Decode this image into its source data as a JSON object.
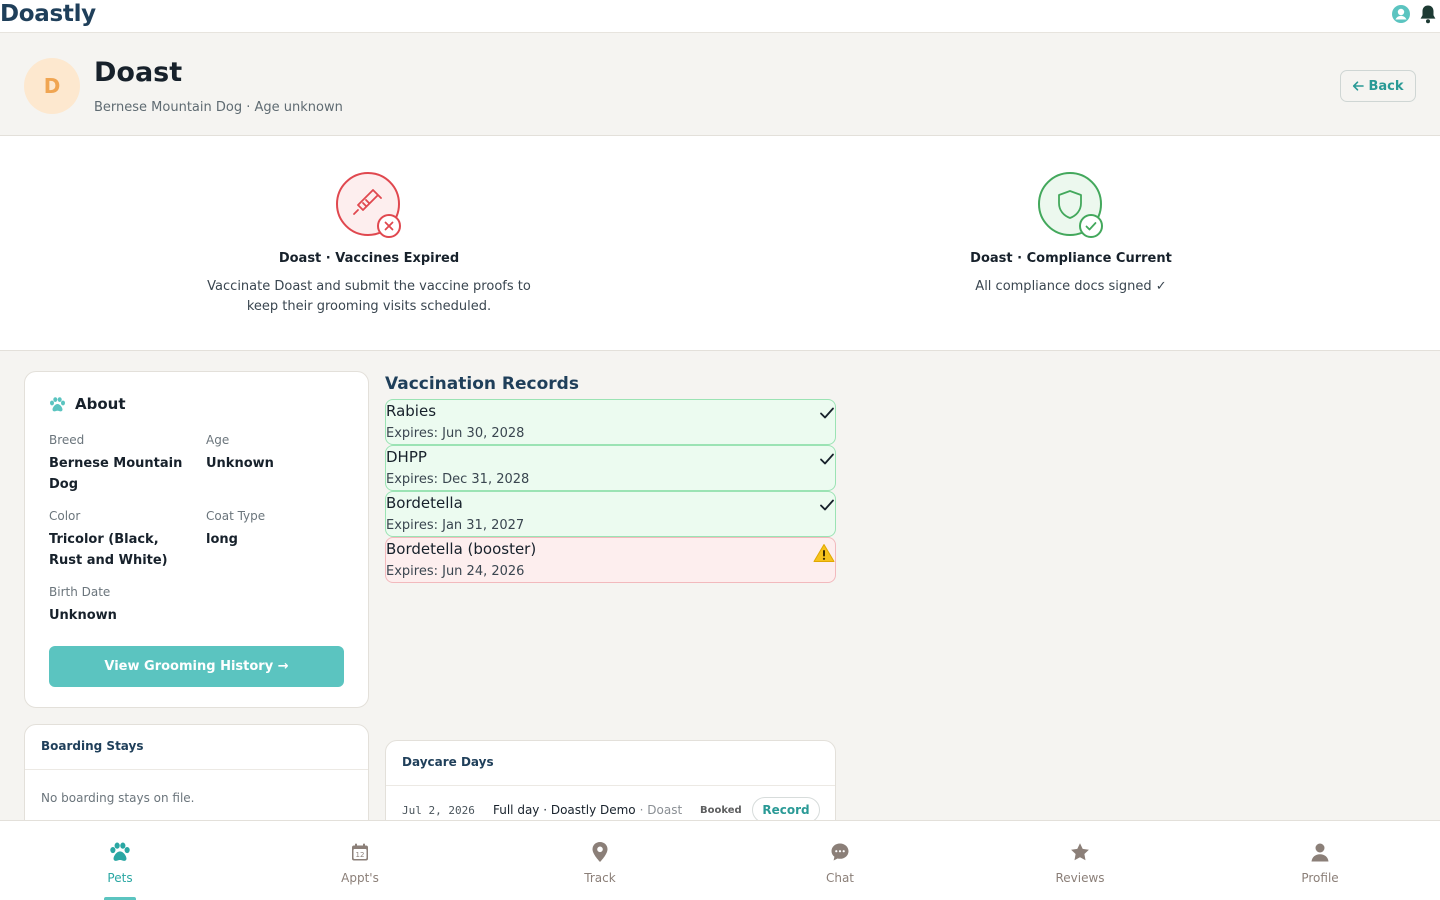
{
  "app": {
    "brand": "Doastly"
  },
  "pet": {
    "initial": "D",
    "name": "Doast",
    "subtitle": "Bernese Mountain Dog · Age unknown",
    "back_label": "Back"
  },
  "status": {
    "vaccines": {
      "title": "Doast · Vaccines Expired",
      "text": "Vaccinate Doast and submit the vaccine proofs to keep their grooming visits scheduled.",
      "color": "#e0484f"
    },
    "compliance": {
      "title": "Doast · Compliance Current",
      "text": "All compliance docs signed ✓",
      "color": "#43a85c"
    }
  },
  "about": {
    "title": "About",
    "fields": [
      {
        "label": "Breed",
        "value": "Bernese Mountain Dog"
      },
      {
        "label": "Age",
        "value": "Unknown"
      },
      {
        "label": "Color",
        "value": "Tricolor (Black, Rust and White)"
      },
      {
        "label": "Coat Type",
        "value": "long"
      },
      {
        "label": "Birth Date",
        "value": "Unknown"
      }
    ],
    "button_label": "View Grooming History →"
  },
  "vaccinations": {
    "title": "Vaccination Records",
    "records": [
      {
        "name": "Rabies",
        "expires": "Expires: Jun 30, 2028",
        "status": "current"
      },
      {
        "name": "DHPP",
        "expires": "Expires: Dec 31, 2028",
        "status": "current"
      },
      {
        "name": "Bordetella",
        "expires": "Expires: Jan 31, 2027",
        "status": "current"
      },
      {
        "name": "Bordetella (booster)",
        "expires": "Expires: Jun 24, 2026",
        "status": "warning"
      }
    ]
  },
  "boarding": {
    "title": "Boarding Stays",
    "empty_text": "No boarding stays on file."
  },
  "daycare": {
    "title": "Daycare Days",
    "rows": [
      {
        "date": "Jul 2, 2026",
        "description": "Full day · Doastly Demo",
        "pet": "· Doast",
        "status": "Booked",
        "action": "Record"
      }
    ]
  },
  "nav": {
    "items": [
      {
        "label": "Pets",
        "icon": "paw-icon",
        "active": true
      },
      {
        "label": "Appt's",
        "icon": "calendar-icon",
        "active": false
      },
      {
        "label": "Track",
        "icon": "map-pin-icon",
        "active": false
      },
      {
        "label": "Chat",
        "icon": "chat-bubble-icon",
        "active": false
      },
      {
        "label": "Reviews",
        "icon": "star-icon",
        "active": false
      },
      {
        "label": "Profile",
        "icon": "person-icon",
        "active": false
      }
    ],
    "calendar_day": "12"
  },
  "colors": {
    "accent": "#5bc4c0",
    "brand": "#1f3f5a",
    "nav_inactive": "#8b7f78"
  }
}
